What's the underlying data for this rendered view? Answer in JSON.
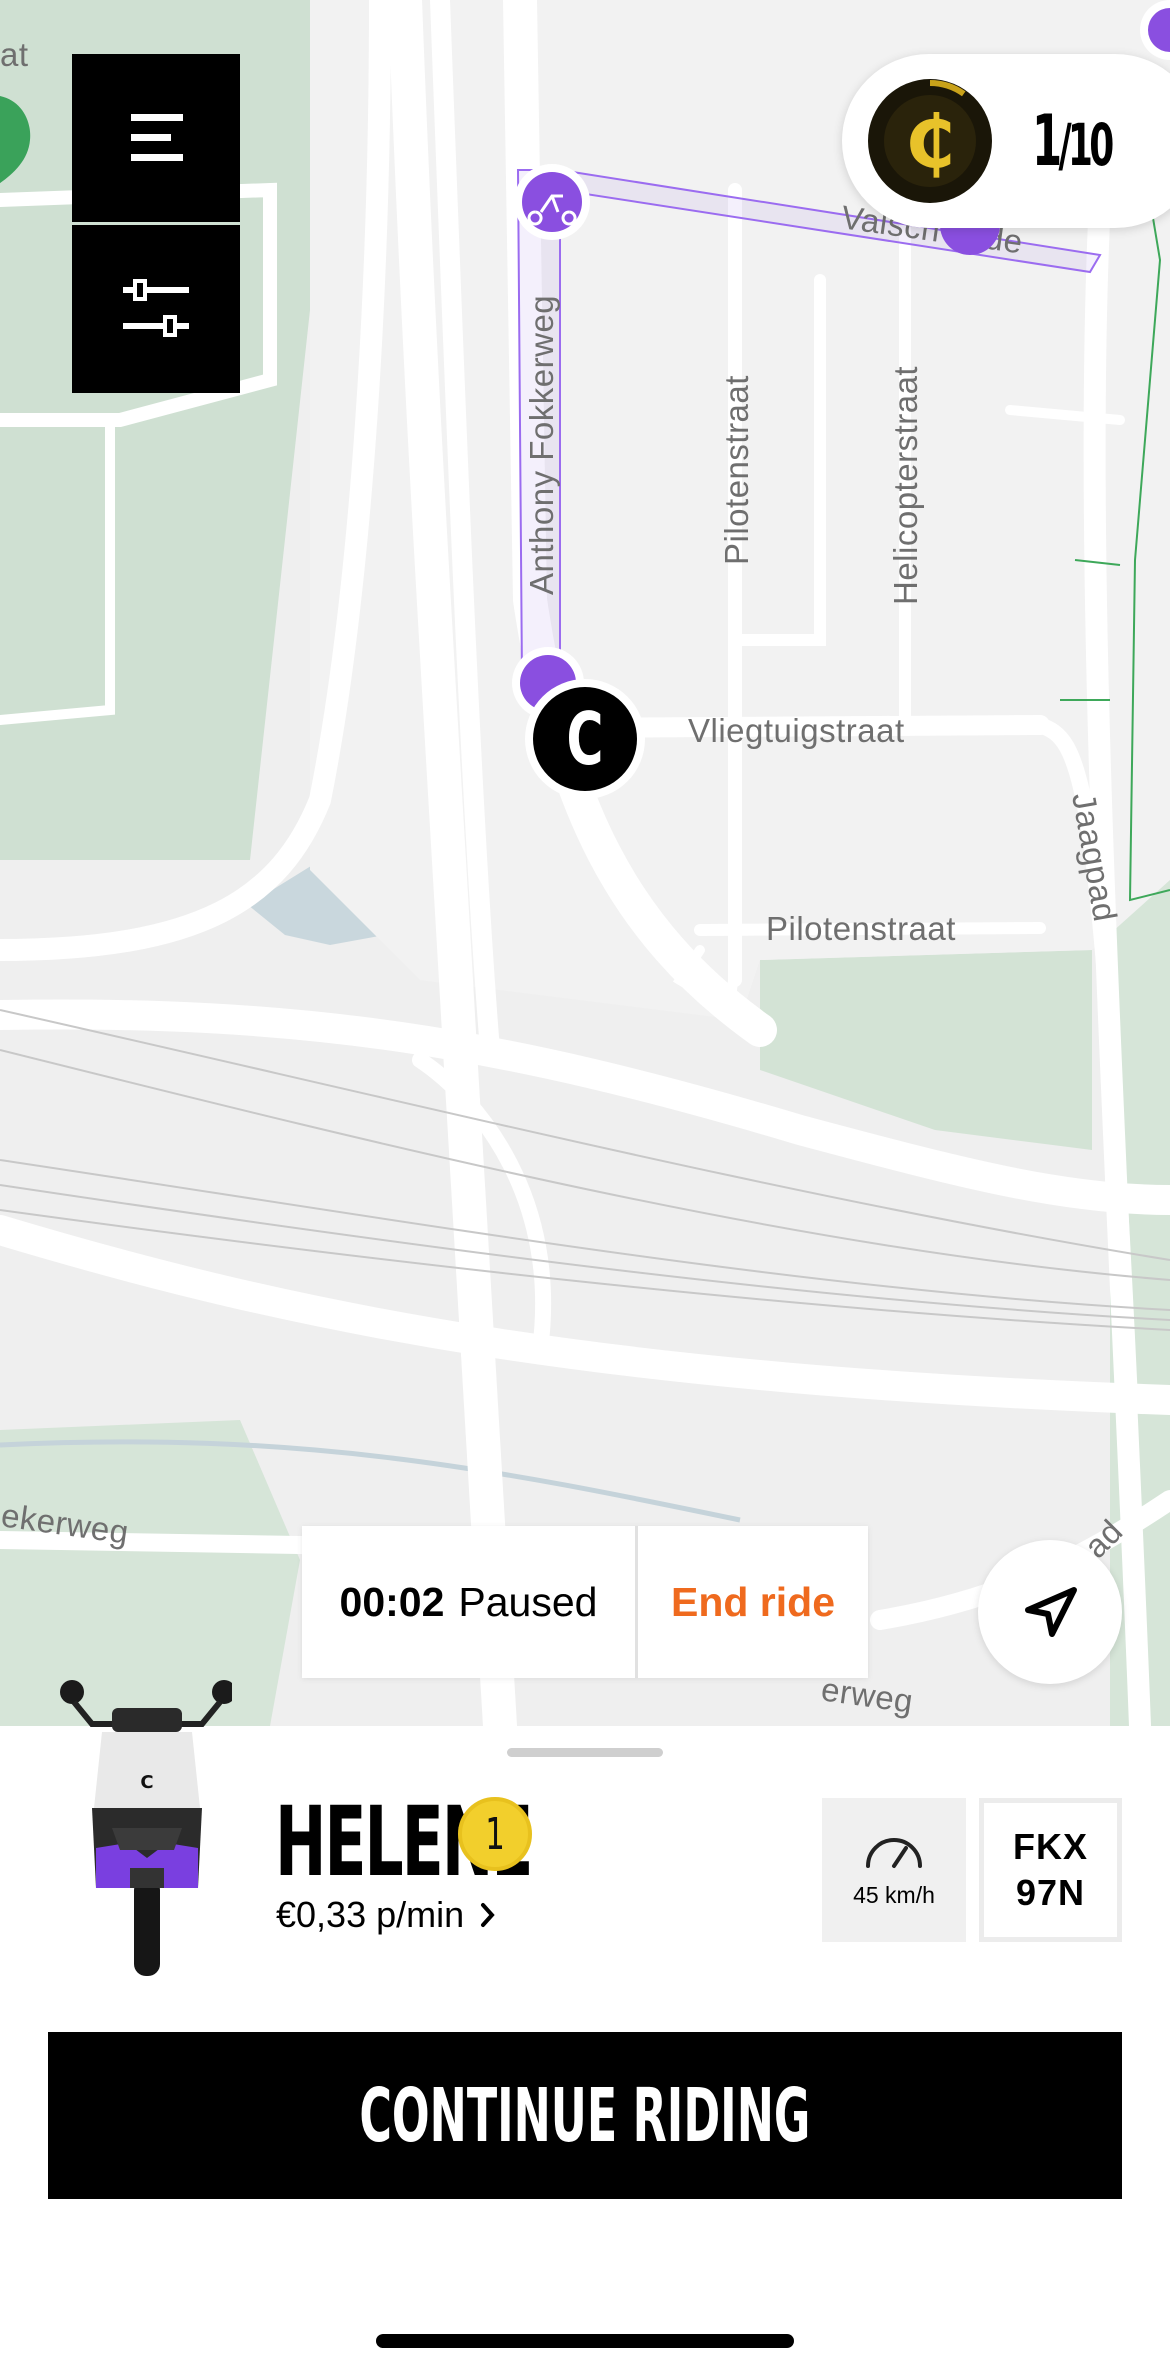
{
  "map": {
    "street_labels": {
      "anthony_fokkerweg": "Anthony Fokkerweg",
      "valsch_kade": "Valsch   kade",
      "pilotenstraat_v": "Pilotenstraat",
      "helicopterstraat": "Helicopterstraat",
      "vliegtuigstraat": "Vliegtuigstraat",
      "pilotenstraat_h": "Pilotenstraat",
      "jaagpad": "Jaagpad",
      "ekerweg": "ekerweg",
      "erweg": "erweg",
      "ad": "ad",
      "at": "at"
    },
    "accent_purple": "#8a4fe0",
    "current_vehicle_marker": "C"
  },
  "controls": {
    "menu_icon": "hamburger-menu-icon",
    "filter_icon": "sliders-icon"
  },
  "coins": {
    "coin_symbol": "₵",
    "count": "1",
    "total": "10",
    "separator": "/"
  },
  "ride": {
    "timer": "00:02",
    "status": "Paused",
    "end_label": "End ride",
    "end_color": "#ef6a1e"
  },
  "vehicle": {
    "name": "HELENE",
    "level": "1",
    "price": "€0,33 p/min",
    "speed": "45 km/h",
    "plate_line1": "FKX",
    "plate_line2": "97N",
    "badge": "C"
  },
  "actions": {
    "continue_label": "CONTINUE RIDING"
  }
}
